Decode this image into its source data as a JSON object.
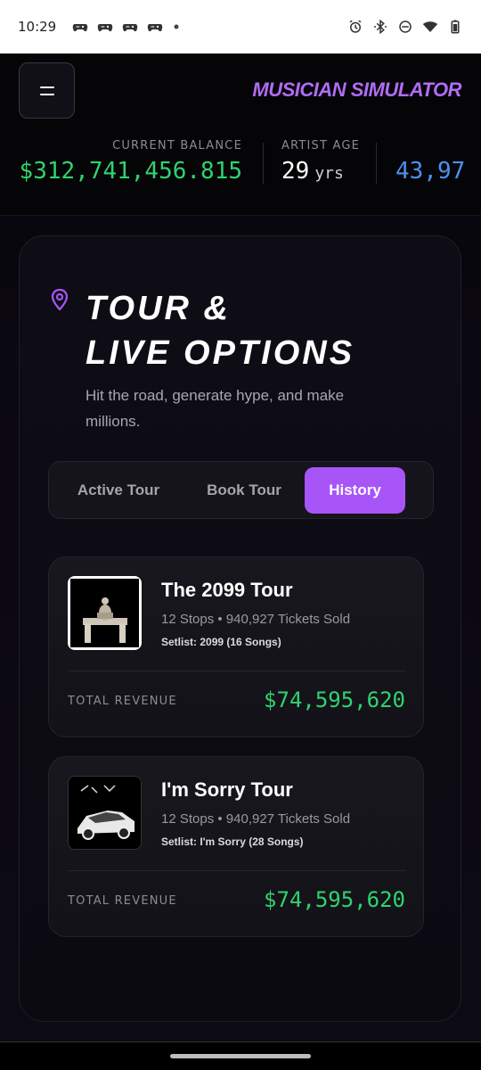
{
  "status_bar": {
    "time": "10:29",
    "left_icons": [
      "game-controller-icon",
      "game-controller-icon",
      "game-controller-icon",
      "game-controller-icon",
      "dot-icon"
    ],
    "right_icons": [
      "alarm-icon",
      "bluetooth-icon",
      "do-not-disturb-icon",
      "wifi-icon",
      "battery-icon"
    ]
  },
  "header": {
    "brand": "MUSICIAN SIMULATOR",
    "menu_icon": "hamburger-icon"
  },
  "stats": {
    "balance_label": "CURRENT BALANCE",
    "balance_value": "$312,741,456.815",
    "age_label": "ARTIST AGE",
    "age_value": "29",
    "age_unit": "yrs",
    "third_value": "43,97"
  },
  "section": {
    "icon": "location-pin-icon",
    "title_line1": "TOUR &",
    "title_line2": "LIVE OPTIONS",
    "subtitle": "Hit the road, generate hype, and make millions."
  },
  "tabs": [
    {
      "label": "Active Tour",
      "active": false
    },
    {
      "label": "Book Tour",
      "active": false
    },
    {
      "label": "History",
      "active": true
    }
  ],
  "tours": [
    {
      "name": "The 2099 Tour",
      "meta": "12 Stops • 940,927 Tickets Sold",
      "setlist": "Setlist: 2099 (16 Songs)",
      "revenue_label": "TOTAL REVENUE",
      "revenue": "$74,595,620"
    },
    {
      "name": "I'm Sorry Tour",
      "meta": "12 Stops • 940,927 Tickets Sold",
      "setlist": "Setlist: I'm Sorry (28 Songs)",
      "revenue_label": "TOTAL REVENUE",
      "revenue": "$74,595,620"
    }
  ],
  "colors": {
    "accent": "#a855f7",
    "brand": "#b06cf5",
    "money": "#2fd36f",
    "blue_stat": "#4c8ff0"
  }
}
